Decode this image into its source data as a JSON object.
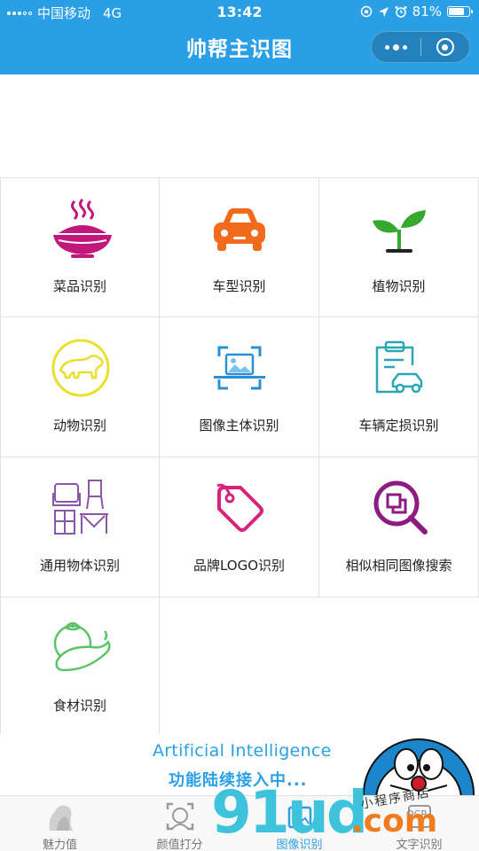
{
  "status_bar": {
    "carrier": "中国移动",
    "network": "4G",
    "time": "13:42",
    "battery": "81%",
    "battery_level": 0.81
  },
  "header": {
    "title": "帅帮主识图",
    "menu_icon": "more-dots-icon",
    "close_icon": "target-ring-icon",
    "color": "#2b9fe6"
  },
  "grid": {
    "items": [
      {
        "label": "菜品识别",
        "icon": "dish-bowl-icon",
        "color": "#c2187b"
      },
      {
        "label": "车型识别",
        "icon": "car-icon",
        "color": "#f26b1d"
      },
      {
        "label": "植物识别",
        "icon": "sprout-icon",
        "color": "#36a82e"
      },
      {
        "label": "动物识别",
        "icon": "polar-bear-icon",
        "color": "#e8e02c"
      },
      {
        "label": "图像主体识别",
        "icon": "image-scan-icon",
        "color": "#2b8fd6"
      },
      {
        "label": "车辆定损识别",
        "icon": "car-clipboard-icon",
        "color": "#2aa7b5"
      },
      {
        "label": "通用物体识别",
        "icon": "furniture-icon",
        "color": "#8a56a8"
      },
      {
        "label": "品牌LOGO识别",
        "icon": "tag-icon",
        "color": "#d8237a"
      },
      {
        "label": "相似相同图像搜索",
        "icon": "image-search-icon",
        "color": "#8d1b80"
      },
      {
        "label": "食材识别",
        "icon": "vegetables-icon",
        "color": "#5cc36a"
      }
    ]
  },
  "banner": {
    "headline": "Artificial Intelligence",
    "subline": "功能陆续接入中...",
    "mascot": "doraemon-icon"
  },
  "tabbar": {
    "tabs": [
      {
        "label": "魅力值",
        "icon": "face-silhouette-icon",
        "active": false
      },
      {
        "label": "颜值打分",
        "icon": "face-frame-icon",
        "active": false
      },
      {
        "label": "图像识别",
        "icon": "image-recognition-icon",
        "active": true
      },
      {
        "label": "文字识别",
        "icon": "ocr-icon",
        "active": false
      }
    ]
  },
  "watermark": {
    "main": "91ud",
    "suffix": ".com",
    "small": "小程序商店",
    "ocr": "OCR"
  }
}
